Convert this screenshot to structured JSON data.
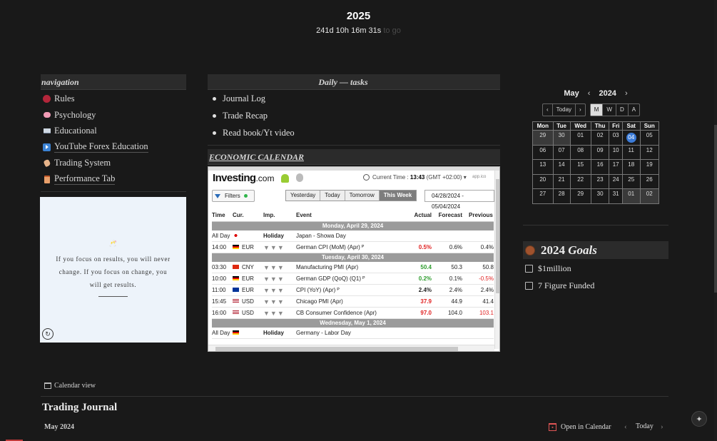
{
  "header": {
    "year": "2025",
    "countdown": "241d 10h 16m 31s",
    "countdown_suffix": "to go"
  },
  "navigation": {
    "title": "navigation",
    "items": [
      {
        "icon": "red-brain-icon",
        "label": "Rules"
      },
      {
        "icon": "brain-icon",
        "label": "Psychology"
      },
      {
        "icon": "book-icon",
        "label": "Educational"
      },
      {
        "icon": "play-icon",
        "label": "YouTube Forex Education"
      },
      {
        "icon": "hand-icon",
        "label": "Trading System"
      },
      {
        "icon": "jar-icon",
        "label": "Performance Tab"
      }
    ]
  },
  "quote": {
    "emoji": "🥂",
    "text": "If you focus on results, you will never change. If you focus on change, you will get results."
  },
  "tasks": {
    "title": "Daily — tasks",
    "items": [
      "Journal Log",
      "Trade Recap",
      "Read book/Yt video"
    ]
  },
  "economic_calendar": {
    "title": "ECONOMIC CALENDAR",
    "logo": "Investing",
    "logo_suffix": ".com",
    "current_time_label": "Current Time :",
    "current_time": "13:43",
    "timezone": "(GMT +02:00)",
    "app_label": "app.ico",
    "filters_label": "Filters",
    "tabs": [
      "Yesterday",
      "Today",
      "Tomorrow",
      "This Week"
    ],
    "active_tab": "This Week",
    "date_range": "04/28/2024 - 05/04/2024",
    "columns": [
      "Time",
      "Cur.",
      "Imp.",
      "Event",
      "Actual",
      "Forecast",
      "Previous"
    ],
    "rows": [
      {
        "type": "day",
        "label": "Monday, April 29, 2024"
      },
      {
        "type": "event",
        "time": "All Day",
        "flag": "japan",
        "cur": "",
        "imp": "Holiday",
        "event": "Japan - Showa Day",
        "actual": "",
        "forecast": "",
        "previous": ""
      },
      {
        "type": "event",
        "time": "14:00",
        "flag": "germany",
        "cur": "EUR",
        "imp": "▼▼▼",
        "event": "German CPI (MoM) (Apr)  ᴾ",
        "actual": "0.5%",
        "actual_style": "red",
        "forecast": "0.6%",
        "previous": "0.4%"
      },
      {
        "type": "day",
        "label": "Tuesday, April 30, 2024"
      },
      {
        "type": "event",
        "time": "03:30",
        "flag": "china",
        "cur": "CNY",
        "imp": "▼▼▼",
        "event": "Manufacturing PMI (Apr)",
        "actual": "50.4",
        "actual_style": "green",
        "forecast": "50.3",
        "previous": "50.8"
      },
      {
        "type": "event",
        "time": "10:00",
        "flag": "germany",
        "cur": "EUR",
        "imp": "▼▼▼",
        "event": "German GDP (QoQ) (Q1)  ᴾ",
        "actual": "0.2%",
        "actual_style": "green",
        "forecast": "0.1%",
        "previous": "-0.5%",
        "previous_style": "red"
      },
      {
        "type": "event",
        "time": "11:00",
        "flag": "eu",
        "cur": "EUR",
        "imp": "▼▼▼",
        "event": "CPI (YoY) (Apr)  ᴾ",
        "actual": "2.4%",
        "actual_style": "black",
        "forecast": "2.4%",
        "previous": "2.4%"
      },
      {
        "type": "event",
        "time": "15:45",
        "flag": "usa",
        "cur": "USD",
        "imp": "▼▼▼",
        "event": "Chicago PMI (Apr)",
        "actual": "37.9",
        "actual_style": "red",
        "forecast": "44.9",
        "previous": "41.4"
      },
      {
        "type": "event",
        "time": "16:00",
        "flag": "usa",
        "cur": "USD",
        "imp": "▼▼▼",
        "event": "CB Consumer Confidence (Apr)",
        "actual": "97.0",
        "actual_style": "red",
        "forecast": "104.0",
        "previous": "103.1",
        "previous_style": "red"
      },
      {
        "type": "day",
        "label": "Wednesday, May 1, 2024"
      },
      {
        "type": "event",
        "time": "All Day",
        "flag": "germany",
        "cur": "",
        "imp": "Holiday",
        "event": "Germany - Labor Day",
        "actual": "",
        "forecast": "",
        "previous": ""
      }
    ]
  },
  "calendar": {
    "month": "May",
    "year": "2024",
    "today_label": "Today",
    "views": [
      "M",
      "W",
      "D",
      "A"
    ],
    "active_view": "M",
    "weekdays": [
      "Mon",
      "Tue",
      "Wed",
      "Thu",
      "Fri",
      "Sat",
      "Sun"
    ],
    "weeks": [
      [
        "29",
        "30",
        "01",
        "02",
        "03",
        "04",
        "05"
      ],
      [
        "06",
        "07",
        "08",
        "09",
        "10",
        "11",
        "12"
      ],
      [
        "13",
        "14",
        "15",
        "16",
        "17",
        "18",
        "19"
      ],
      [
        "20",
        "21",
        "22",
        "23",
        "24",
        "25",
        "26"
      ],
      [
        "27",
        "28",
        "29",
        "30",
        "31",
        "01",
        "02"
      ]
    ],
    "today": "04"
  },
  "goals": {
    "year": "2024",
    "title_word": "Goals",
    "items": [
      "$1million",
      "7 Figure Funded"
    ]
  },
  "journal": {
    "calendar_view_label": "Calendar view",
    "title": "Trading Journal",
    "month": "May 2024",
    "open_in_calendar": "Open in Calendar",
    "today_label": "Today"
  },
  "colors": {
    "background": "#191919",
    "today_highlight": "#3b7bd8",
    "quote_card": "#edf3fa"
  }
}
